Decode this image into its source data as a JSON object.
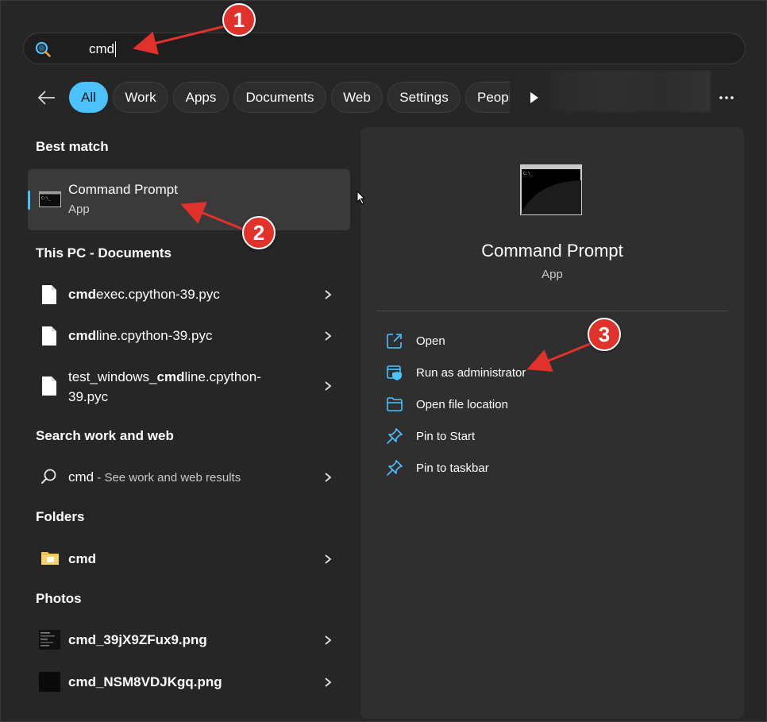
{
  "search": {
    "query": "cmd"
  },
  "tabs": [
    {
      "label": "All",
      "active": true
    },
    {
      "label": "Work"
    },
    {
      "label": "Apps"
    },
    {
      "label": "Documents"
    },
    {
      "label": "Web"
    },
    {
      "label": "Settings"
    },
    {
      "label": "Peopl"
    }
  ],
  "sections": {
    "best_match": "Best match",
    "documents": "This PC - Documents",
    "web": "Search work and web",
    "folders": "Folders",
    "photos": "Photos"
  },
  "best_match": {
    "name": "Command Prompt",
    "type": "App"
  },
  "documents": [
    {
      "bold": "cmd",
      "rest": "exec.cpython-39.pyc"
    },
    {
      "bold": "cmd",
      "rest": "line.cpython-39.pyc"
    },
    {
      "pre": "test_windows_",
      "bold": "cmd",
      "rest": "line.cpython-",
      "line2": "39.pyc"
    }
  ],
  "web": {
    "query": "cmd",
    "hint": " - See work and web results"
  },
  "folders": [
    {
      "name": "cmd"
    }
  ],
  "photos": [
    {
      "name": "cmd_39jX9ZFux9.png"
    },
    {
      "name": "cmd_NSM8VDJKgq.png"
    }
  ],
  "detail": {
    "title": "Command Prompt",
    "subtitle": "App",
    "actions": [
      {
        "label": "Open",
        "icon": "open-external-icon"
      },
      {
        "label": "Run as administrator",
        "icon": "shield-window-icon"
      },
      {
        "label": "Open file location",
        "icon": "folder-icon"
      },
      {
        "label": "Pin to Start",
        "icon": "pin-icon"
      },
      {
        "label": "Pin to taskbar",
        "icon": "pin-icon"
      }
    ]
  },
  "annotations": [
    {
      "number": "1"
    },
    {
      "number": "2"
    },
    {
      "number": "3"
    }
  ],
  "colors": {
    "accent": "#4cc2ff",
    "annotation": "#e0322b",
    "background": "#262626",
    "panel": "#2f2f2f"
  }
}
